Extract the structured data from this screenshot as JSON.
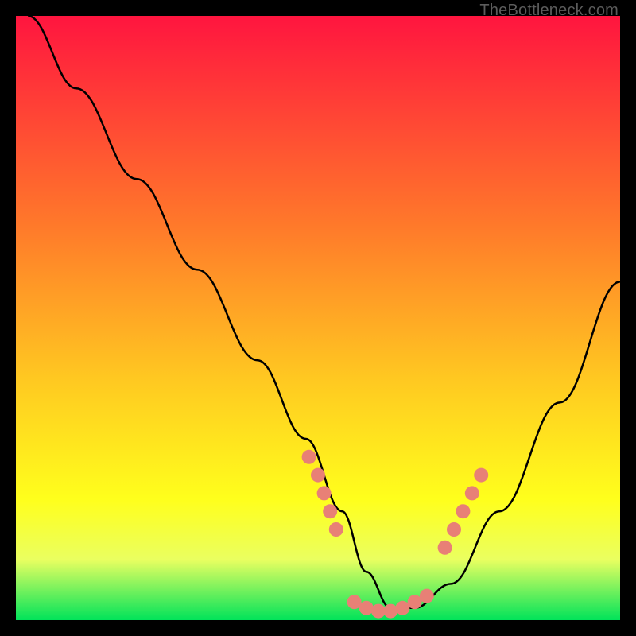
{
  "watermark": "TheBottleneck.com",
  "colors": {
    "gradient_top": "#ff153f",
    "gradient_mid1": "#ff6a2f",
    "gradient_mid2": "#ffc821",
    "gradient_mid3": "#ffff1c",
    "gradient_bottom": "#00e35a",
    "curve": "#000000",
    "dots": "#e88076",
    "frame": "#000000"
  },
  "chart_data": {
    "type": "line",
    "title": "",
    "xlabel": "",
    "ylabel": "",
    "xlim": [
      0,
      100
    ],
    "ylim": [
      0,
      100
    ],
    "series": [
      {
        "name": "curve",
        "x": [
          2,
          10,
          20,
          30,
          40,
          48,
          54,
          58,
          62,
          66,
          72,
          80,
          90,
          100
        ],
        "y": [
          100,
          88,
          73,
          58,
          43,
          30,
          18,
          8,
          2,
          2,
          6,
          18,
          36,
          56
        ]
      },
      {
        "name": "dots-left",
        "x": [
          48.5,
          50,
          51,
          52,
          53
        ],
        "y": [
          27,
          24,
          21,
          18,
          15
        ]
      },
      {
        "name": "dots-bottom",
        "x": [
          56,
          58,
          60,
          62,
          64,
          66,
          68
        ],
        "y": [
          3,
          2,
          1.5,
          1.5,
          2,
          3,
          4
        ]
      },
      {
        "name": "dots-right",
        "x": [
          71,
          72.5,
          74,
          75.5,
          77
        ],
        "y": [
          12,
          15,
          18,
          21,
          24
        ]
      }
    ]
  }
}
